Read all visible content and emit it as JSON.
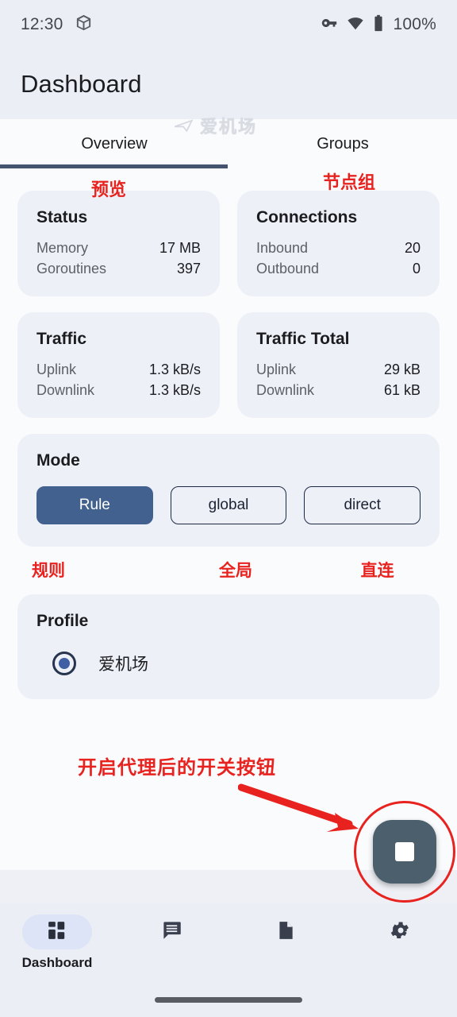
{
  "statusbar": {
    "time": "12:30",
    "package_icon": "package-icon",
    "vpn_key_icon": "vpn-key-icon",
    "wifi_icon": "wifi-icon",
    "battery_icon": "battery-icon",
    "battery_label": "100%"
  },
  "appbar": {
    "title": "Dashboard"
  },
  "watermark": {
    "text": "爱机场",
    "icon": "airplane-icon"
  },
  "tabs": {
    "items": [
      {
        "label": "Overview",
        "annotation": "预览",
        "active": true
      },
      {
        "label": "Groups",
        "annotation": "节点组",
        "active": false
      }
    ]
  },
  "cards": {
    "status": {
      "title": "Status",
      "rows": [
        {
          "key": "Memory",
          "value": "17 MB"
        },
        {
          "key": "Goroutines",
          "value": "397"
        }
      ]
    },
    "connections": {
      "title": "Connections",
      "rows": [
        {
          "key": "Inbound",
          "value": "20"
        },
        {
          "key": "Outbound",
          "value": "0"
        }
      ]
    },
    "traffic": {
      "title": "Traffic",
      "rows": [
        {
          "key": "Uplink",
          "value": "1.3 kB/s"
        },
        {
          "key": "Downlink",
          "value": "1.3 kB/s"
        }
      ]
    },
    "traffic_total": {
      "title": "Traffic Total",
      "rows": [
        {
          "key": "Uplink",
          "value": "29 kB"
        },
        {
          "key": "Downlink",
          "value": "61 kB"
        }
      ]
    }
  },
  "mode": {
    "title": "Mode",
    "options": [
      {
        "label": "Rule",
        "annotation": "规则",
        "selected": true
      },
      {
        "label": "global",
        "annotation": "全局",
        "selected": false
      },
      {
        "label": "direct",
        "annotation": "直连",
        "selected": false
      }
    ]
  },
  "profile": {
    "title": "Profile",
    "selected_name": "爱机场"
  },
  "fab": {
    "annotation": "开启代理后的开关按钮",
    "icon": "stop-square-icon"
  },
  "bottomnav": {
    "items": [
      {
        "label": "Dashboard",
        "icon": "grid-dashboard-icon",
        "active": true
      },
      {
        "label": "",
        "icon": "chat-proxies-icon",
        "active": false
      },
      {
        "label": "",
        "icon": "document-logs-icon",
        "active": false
      },
      {
        "label": "",
        "icon": "gear-settings-icon",
        "active": false
      }
    ]
  },
  "colors": {
    "accent_blue": "#42618f",
    "tab_indicator": "#44546f",
    "annotation_red": "#e8231f",
    "fab_bg": "#4b606c",
    "card_bg": "#eef0f7",
    "page_bg": "#fafbfd",
    "chrome_bg": "#eceef5"
  }
}
